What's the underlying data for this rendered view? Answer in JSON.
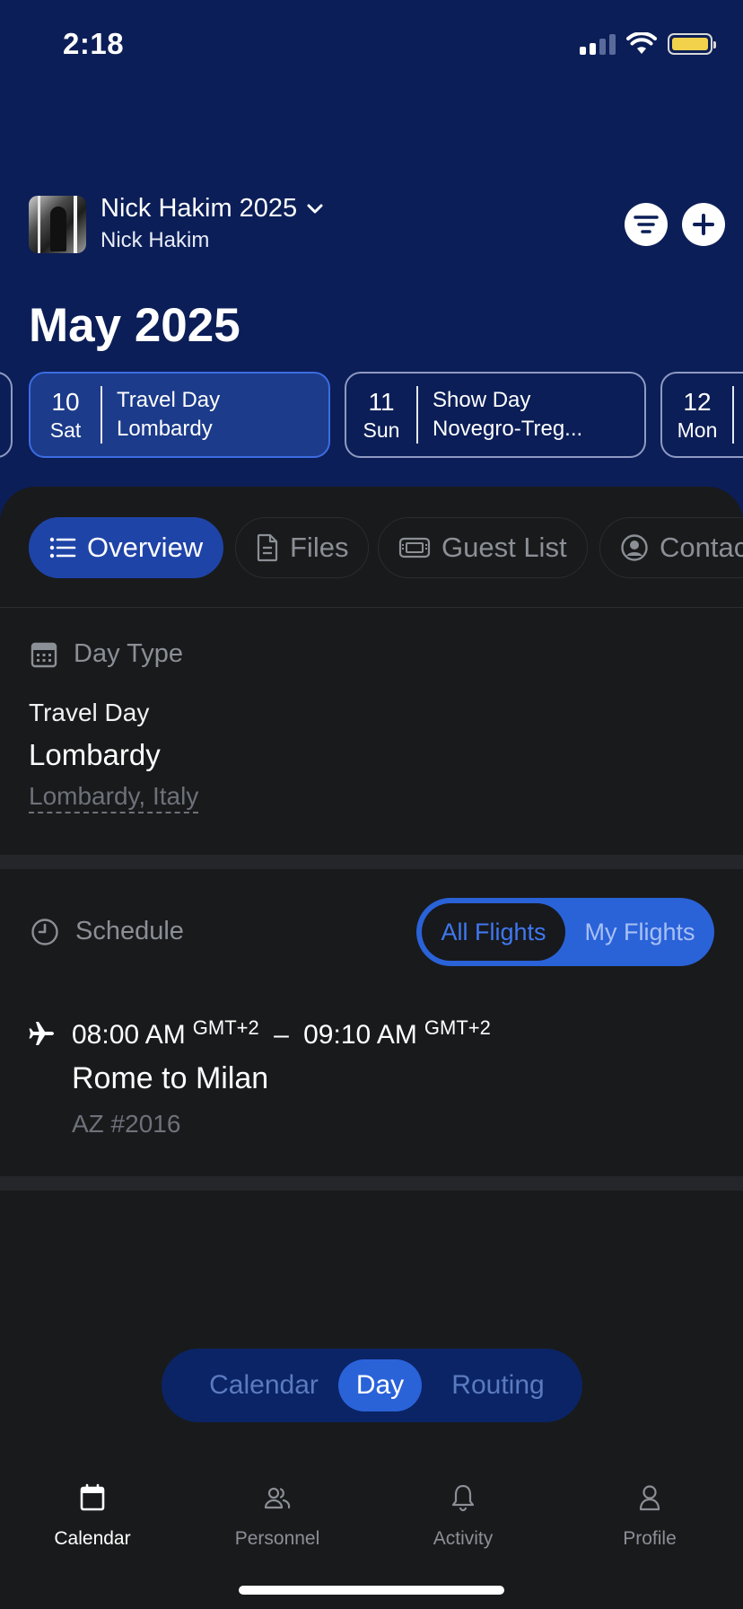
{
  "status": {
    "time": "2:18"
  },
  "project": {
    "title": "Nick Hakim 2025",
    "subtitle": "Nick Hakim"
  },
  "month": "May 2025",
  "days": [
    {
      "num": "10",
      "weekday": "Sat",
      "type": "Travel Day",
      "place": "Lombardy",
      "selected": true
    },
    {
      "num": "11",
      "weekday": "Sun",
      "type": "Show Day",
      "place": "Novegro-Treg...",
      "selected": false
    },
    {
      "num": "12",
      "weekday": "Mon",
      "type": "",
      "place": "",
      "selected": false
    }
  ],
  "tabs": [
    {
      "label": "Overview",
      "icon": "list-icon",
      "active": true
    },
    {
      "label": "Files",
      "icon": "file-icon",
      "active": false
    },
    {
      "label": "Guest List",
      "icon": "ticket-icon",
      "active": false
    },
    {
      "label": "Contac",
      "icon": "user-circle-icon",
      "active": false
    }
  ],
  "day_type": {
    "label": "Day Type",
    "kind": "Travel Day",
    "place": "Lombardy",
    "location": "Lombardy, Italy"
  },
  "schedule": {
    "label": "Schedule",
    "toggle": {
      "all": "All Flights",
      "mine": "My Flights",
      "selected": "all"
    },
    "flight": {
      "depart_time": "08:00 AM",
      "depart_tz": "GMT+2",
      "separator": "–",
      "arrive_time": "09:10 AM",
      "arrive_tz": "GMT+2",
      "route": "Rome to Milan",
      "number": "AZ #2016"
    }
  },
  "view_switch": {
    "options": [
      "Calendar",
      "Day",
      "Routing"
    ],
    "selected": "Day"
  },
  "tabbar": [
    {
      "label": "Calendar",
      "icon": "calendar-icon",
      "active": true
    },
    {
      "label": "Personnel",
      "icon": "people-icon",
      "active": false
    },
    {
      "label": "Activity",
      "icon": "bell-icon",
      "active": false
    },
    {
      "label": "Profile",
      "icon": "person-icon",
      "active": false
    }
  ],
  "colors": {
    "header_bg": "#0b1e57",
    "panel_bg": "#191a1b",
    "accent": "#2a62d8",
    "muted": "#8b8f96",
    "battery": "#f2d24b"
  }
}
